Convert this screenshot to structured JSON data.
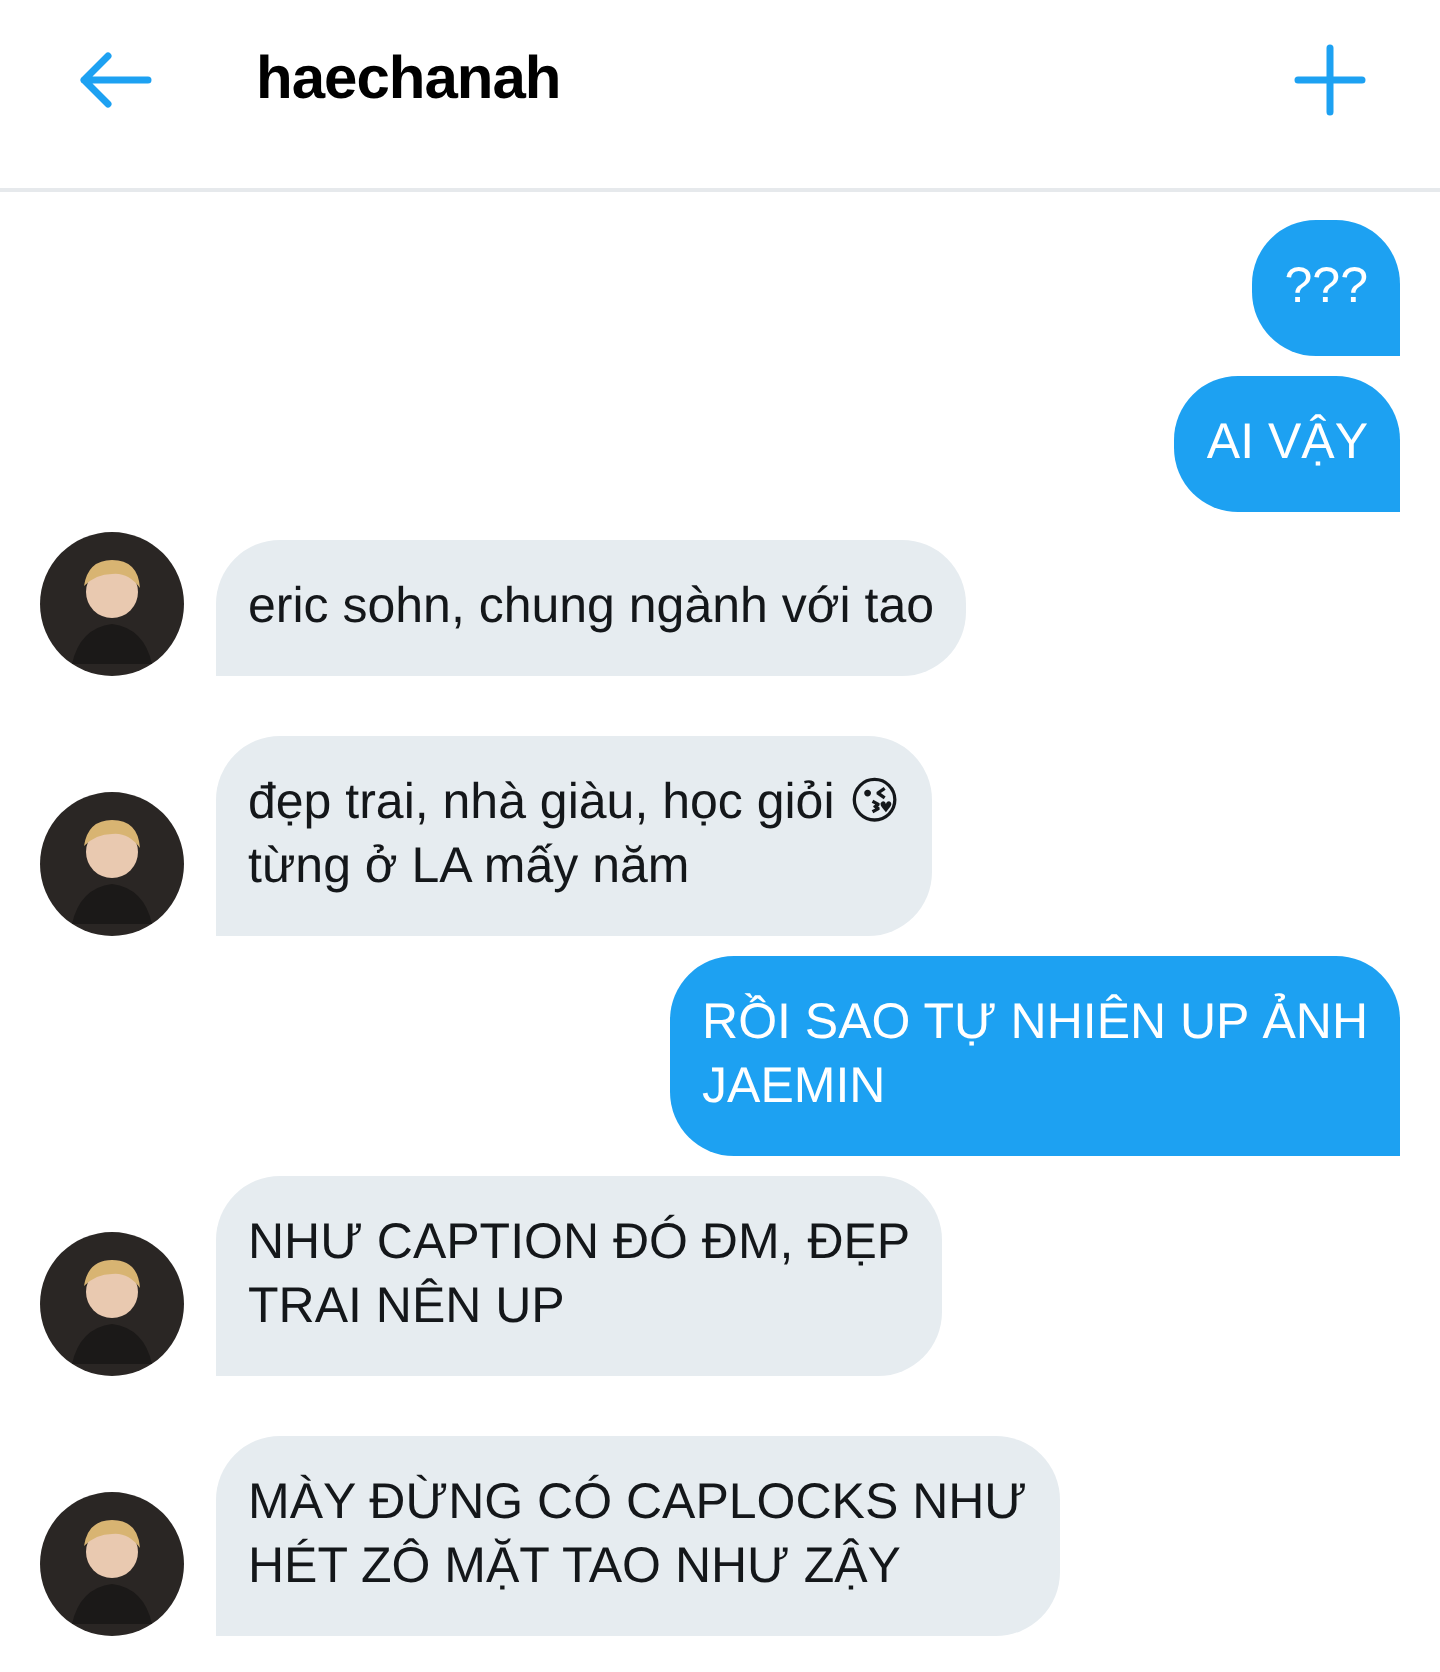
{
  "header": {
    "title": "haechanah"
  },
  "messages": [
    {
      "kind": "sent",
      "text": "???"
    },
    {
      "kind": "sent",
      "text": "AI VẬY"
    },
    {
      "kind": "received",
      "text": "eric sohn, chung ngành với tao"
    },
    {
      "kind": "received",
      "text": "đẹp trai, nhà giàu, học giỏi 😘\ntừng ở LA mấy năm"
    },
    {
      "kind": "sent",
      "text": "RỒI SAO TỰ NHIÊN UP ẢNH\nJAEMIN"
    },
    {
      "kind": "received",
      "text": "NHƯ CAPTION ĐÓ ĐM, ĐẸP\nTRAI NÊN UP"
    },
    {
      "kind": "received",
      "text": "MÀY ĐỪNG CÓ CAPLOCKS NHƯ\nHÉT ZÔ MẶT TAO NHƯ ZẬY"
    }
  ]
}
